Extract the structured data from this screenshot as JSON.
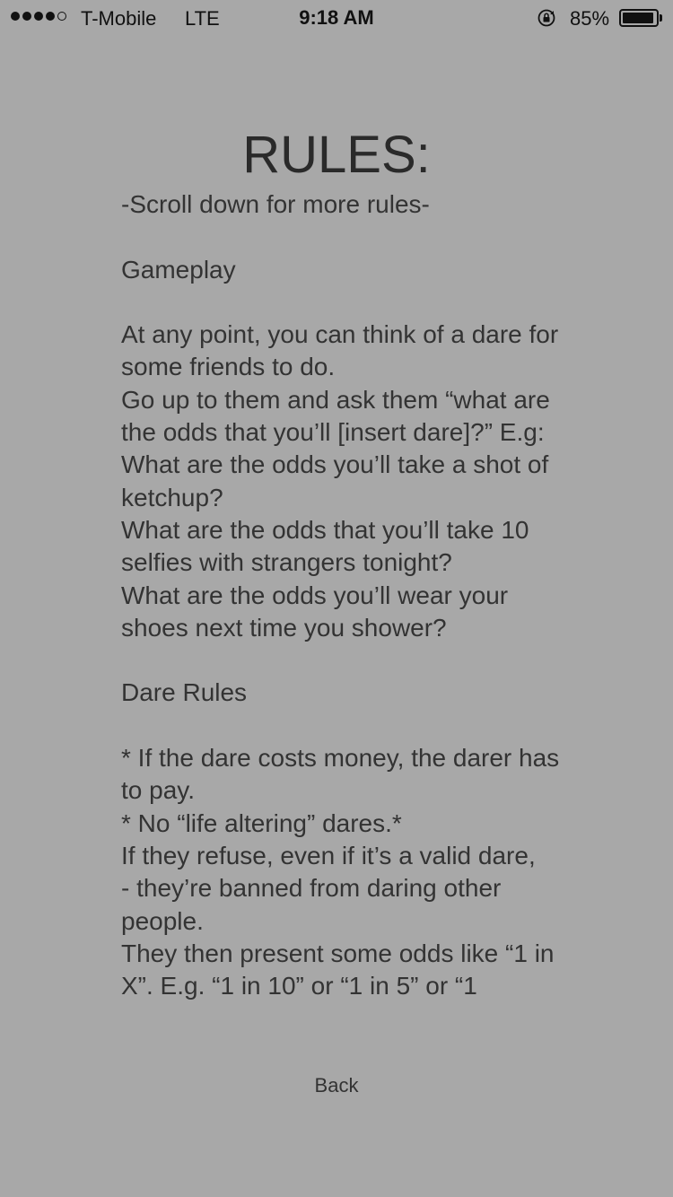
{
  "status_bar": {
    "carrier": "T-Mobile",
    "network": "LTE",
    "time": "9:18 AM",
    "battery_percent": "85%",
    "battery_level": 0.85,
    "signal_bars": 4,
    "icons": [
      "signal-dots-icon",
      "rotation-lock-icon",
      "battery-icon"
    ]
  },
  "title": "RULES:",
  "rules_lines": [
    "-Scroll down for more rules-",
    "",
    "Gameplay",
    "",
    "At any point, you can think of a dare for some friends to do.",
    "Go up to them and ask them “what are the odds that you’ll [insert dare]?” E.g:",
    "What are the odds you’ll take a shot of ketchup?",
    "What are the odds that you’ll take 10 selfies with strangers tonight?",
    "What are the odds you’ll wear your shoes next time you shower?",
    "",
    "Dare Rules",
    "",
    "* If the dare costs money, the darer has to pay.",
    "* No “life altering” dares.*",
    "If they refuse, even if it’s a valid dare,",
    " - they’re banned from daring other people.",
    "They then present some odds like “1 in X”. E.g. “1 in 10” or “1 in 5” or “1"
  ],
  "back_label": "Back",
  "colors": {
    "background": "#a8a8a8",
    "text": "#2a2a2a"
  }
}
